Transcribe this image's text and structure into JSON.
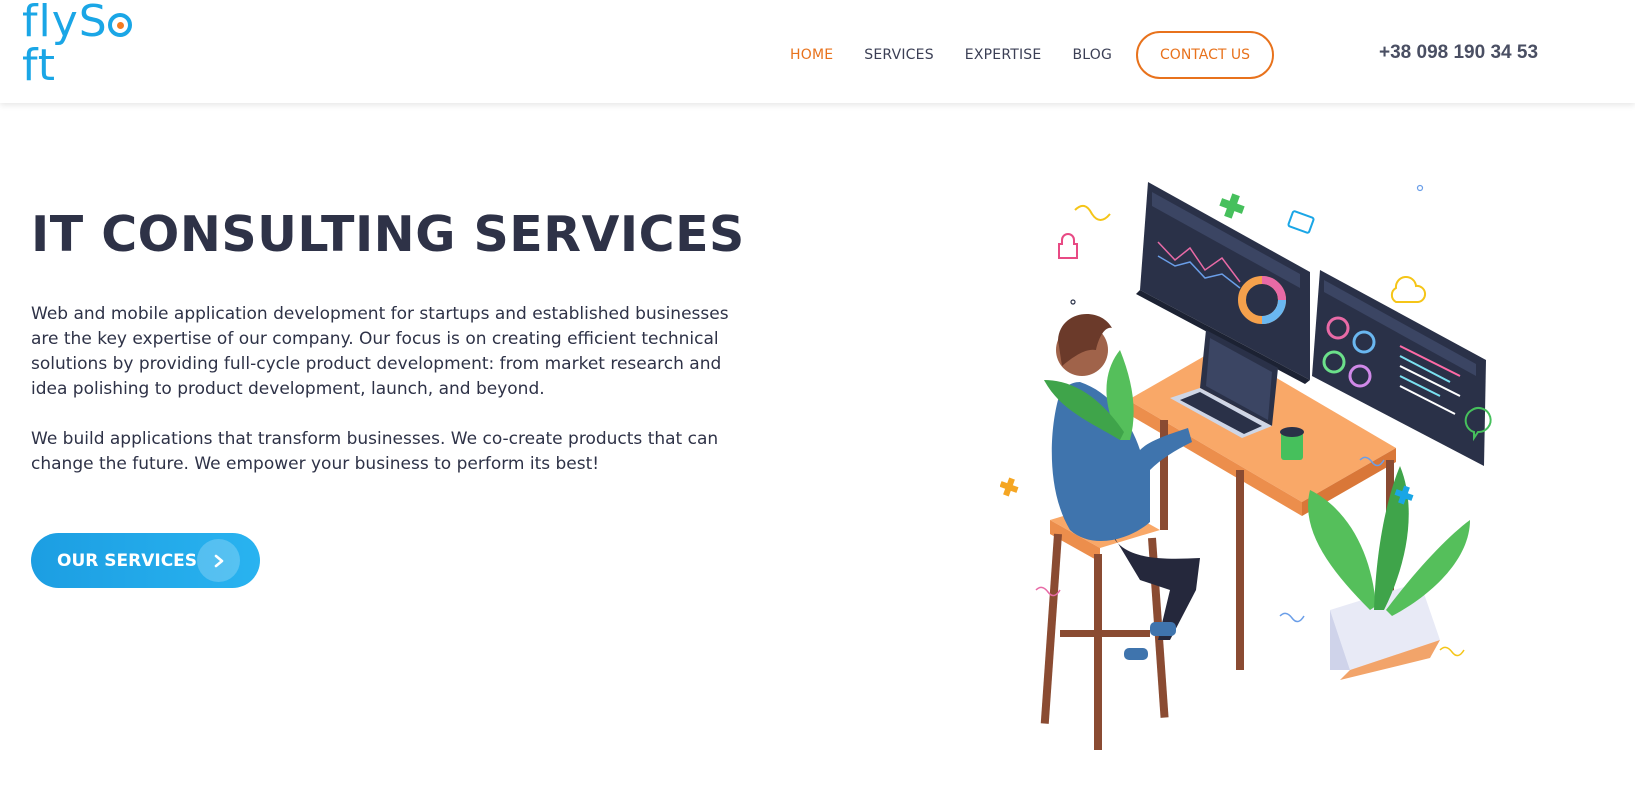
{
  "header": {
    "logo_text": "flySoft",
    "nav": [
      {
        "label": "HOME",
        "active": true
      },
      {
        "label": "SERVICES",
        "active": false
      },
      {
        "label": "EXPERTISE",
        "active": false
      },
      {
        "label": "BLOG",
        "active": false
      }
    ],
    "contact_label": "CONTACT US",
    "phone": "+38 098 190 34 53"
  },
  "hero": {
    "title": "IT CONSULTING SERVICES",
    "paragraph1": "Web and mobile application development for startups and established businesses are the key expertise of our company. Our focus is on creating efficient technical solutions by providing full-cycle product development: from market research and idea polishing to product development, launch, and beyond.",
    "paragraph2": "We build applications that transform businesses. We co-create products that can change the future. We empower your business to perform its best!",
    "cta_label": "OUR SERVICES"
  },
  "colors": {
    "accent_orange": "#e8721c",
    "brand_blue": "#1aa6e6",
    "text_dark": "#2e3247"
  },
  "icons": {
    "cta_arrow": "chevron-right-icon"
  }
}
